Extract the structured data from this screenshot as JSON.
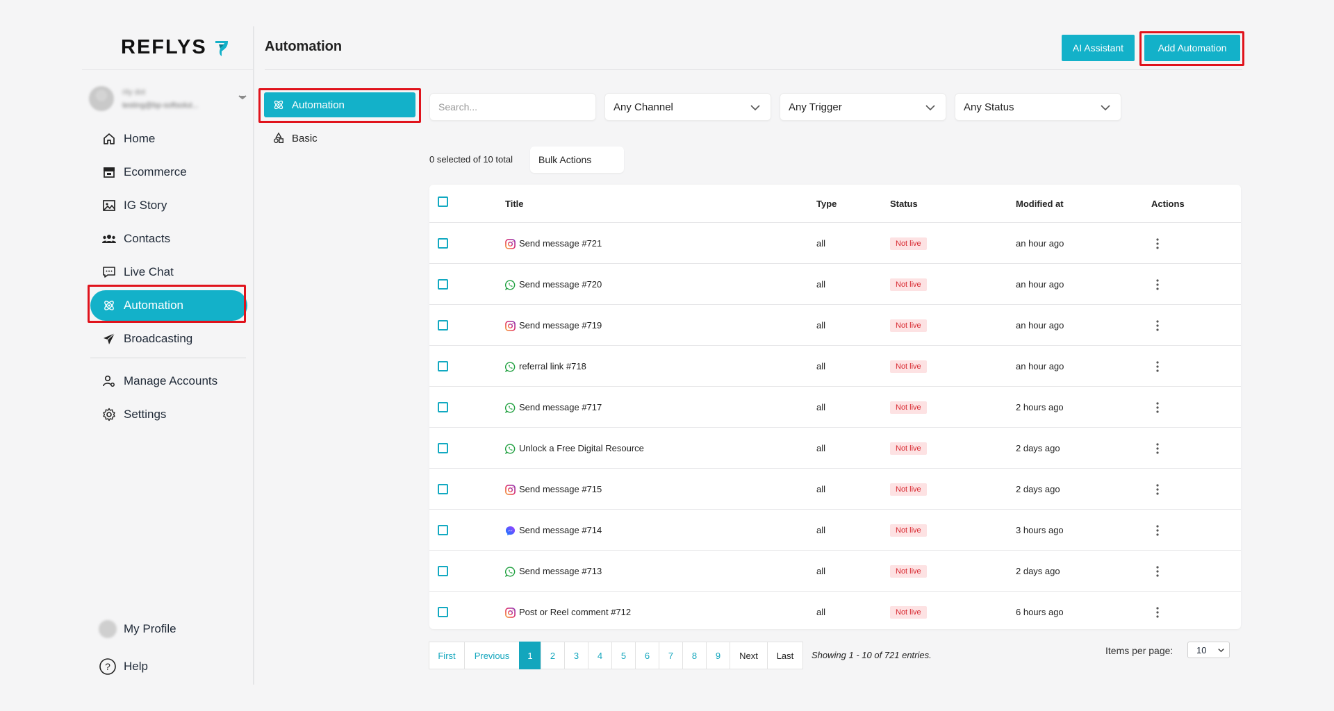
{
  "brand": {
    "name": "REFLYS",
    "accent": "#13b1c9"
  },
  "account": {
    "name": "rity dot",
    "email": "testing@bp-softsolut..."
  },
  "sidebar": {
    "items": [
      {
        "label": "Home",
        "icon": "home-icon"
      },
      {
        "label": "Ecommerce",
        "icon": "store-icon"
      },
      {
        "label": "IG Story",
        "icon": "image-icon"
      },
      {
        "label": "Contacts",
        "icon": "users-icon"
      },
      {
        "label": "Live Chat",
        "icon": "chat-icon"
      },
      {
        "label": "Automation",
        "icon": "atom-icon",
        "active": true
      },
      {
        "label": "Broadcasting",
        "icon": "send-icon"
      }
    ],
    "secondary": [
      {
        "label": "Manage Accounts",
        "icon": "user-cog-icon"
      },
      {
        "label": "Settings",
        "icon": "gear-icon"
      }
    ],
    "profile_label": "My Profile",
    "help_label": "Help"
  },
  "header": {
    "title": "Automation",
    "ai_button": "AI Assistant",
    "add_button": "Add Automation"
  },
  "subnav": [
    {
      "label": "Automation",
      "active": true
    },
    {
      "label": "Basic"
    }
  ],
  "filters": {
    "search_placeholder": "Search...",
    "channel": "Any Channel",
    "trigger": "Any Trigger",
    "status": "Any Status"
  },
  "selection": {
    "count_text": "0 selected of 10 total",
    "bulk_label": "Bulk Actions"
  },
  "table": {
    "columns": [
      "Title",
      "Type",
      "Status",
      "Modified at",
      "Actions"
    ],
    "rows": [
      {
        "channel": "instagram",
        "title": "Send message #721",
        "type": "all",
        "status": "Not live",
        "modified": "an hour ago"
      },
      {
        "channel": "whatsapp",
        "title": "Send message #720",
        "type": "all",
        "status": "Not live",
        "modified": "an hour ago"
      },
      {
        "channel": "instagram",
        "title": "Send message #719",
        "type": "all",
        "status": "Not live",
        "modified": "an hour ago"
      },
      {
        "channel": "whatsapp",
        "title": "referral link #718",
        "type": "all",
        "status": "Not live",
        "modified": "an hour ago"
      },
      {
        "channel": "whatsapp",
        "title": "Send message #717",
        "type": "all",
        "status": "Not live",
        "modified": "2 hours ago"
      },
      {
        "channel": "whatsapp",
        "title": "Unlock a Free Digital Resource",
        "type": "all",
        "status": "Not live",
        "modified": "2 days ago"
      },
      {
        "channel": "instagram",
        "title": "Send message #715",
        "type": "all",
        "status": "Not live",
        "modified": "2 days ago"
      },
      {
        "channel": "messenger",
        "title": "Send message #714",
        "type": "all",
        "status": "Not live",
        "modified": "3 hours ago"
      },
      {
        "channel": "whatsapp",
        "title": "Send message #713",
        "type": "all",
        "status": "Not live",
        "modified": "2 days ago"
      },
      {
        "channel": "instagram",
        "title": "Post or Reel comment #712",
        "type": "all",
        "status": "Not live",
        "modified": "6 hours ago"
      }
    ]
  },
  "pagination": {
    "first": "First",
    "previous": "Previous",
    "next": "Next",
    "last": "Last",
    "pages": [
      "1",
      "2",
      "3",
      "4",
      "5",
      "6",
      "7",
      "8",
      "9"
    ],
    "current": "1",
    "showing": "Showing 1 - 10 of 721 entries.",
    "items_per_page_label": "Items per page:",
    "items_per_page": "10"
  }
}
